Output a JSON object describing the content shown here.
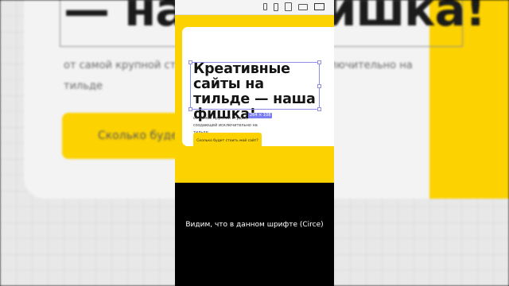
{
  "background": {
    "heading": "— наша фишка!",
    "description": "от самой крупной студии, создающей сайты исключительно на тильде",
    "button_label": "Сколько будет стоить мой сайт?"
  },
  "editor": {
    "device_icons": [
      "phone-small-icon",
      "phone-icon",
      "tablet-icon",
      "laptop-icon",
      "desktop-icon"
    ],
    "size_tag": "264 × 108"
  },
  "hero": {
    "title": "Креативные сайты на тильде — наша фишка!",
    "description": "от самой крупной студии, создающей исключительно на тильде",
    "button_label": "Сколько будет стоить мой сайт?"
  },
  "caption": "Видим, что в данном шрифте (Circe)",
  "colors": {
    "accent_yellow": "#fcd200",
    "selection": "#8c8ee8",
    "text_dark": "#141414"
  }
}
